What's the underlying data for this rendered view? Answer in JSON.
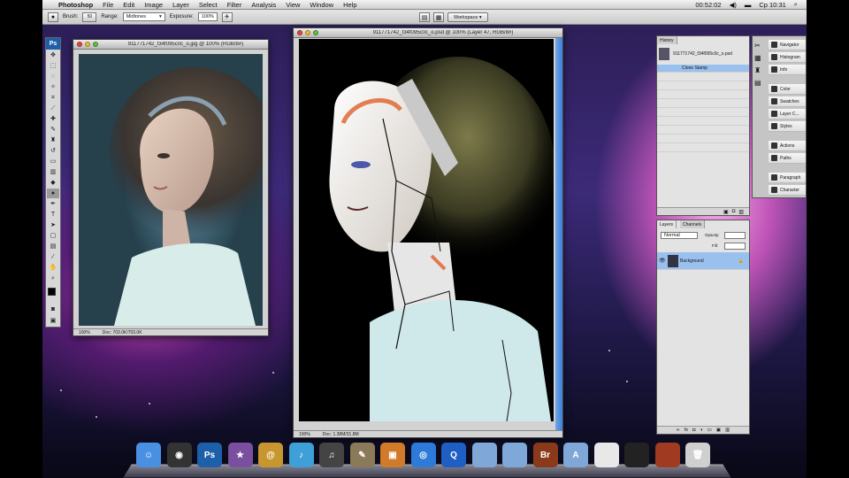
{
  "menubar": {
    "apple": "",
    "app_name": "Photoshop",
    "items": [
      "File",
      "Edit",
      "Image",
      "Layer",
      "Select",
      "Filter",
      "Analysis",
      "View",
      "Window",
      "Help"
    ],
    "clock_small": "00:52:02",
    "clock": "Cp 10:31"
  },
  "optionsbar": {
    "brush_label": "Brush:",
    "brush_size": "50",
    "range_label": "Range:",
    "range_value": "Midtones",
    "exposure_label": "Exposure:",
    "exposure_value": "100%",
    "workspace_label": "Workspace ▾"
  },
  "toolbox": {
    "logo": "Ps"
  },
  "doc_left": {
    "title": "911771742_f34f095c0c_o.jpg @ 100% (RGB/8#)",
    "zoom": "100%",
    "doc_size": "Doc: 703.0K/703.0K"
  },
  "doc_right": {
    "title": "911771742_f34f095c0c_o.psd @ 100% (Layer 47, RGB/8#)",
    "zoom": "100%",
    "doc_size": "Doc: 1.38M/31.8M"
  },
  "history_panel": {
    "tab": "History",
    "snapshot": "911771742_f34f095c0c_o.psd",
    "selected_item": "Clone Stamp"
  },
  "layers_panel": {
    "tab_layers": "Layers",
    "tab_channels": "Channels",
    "blend_mode": "Normal",
    "opacity_label": "Opacity:",
    "fill_label": "Fill:",
    "layer_name": "Background"
  },
  "dock_panels": [
    "Navigator",
    "Histogram",
    "Info",
    "Color",
    "Swatches",
    "Layer C...",
    "Styles",
    "Actions",
    "Paths",
    "Paragraph",
    "Character"
  ],
  "dock_apps": [
    {
      "name": "finder-icon",
      "glyph": "☺",
      "color": "#4a90e2"
    },
    {
      "name": "dashboard-icon",
      "glyph": "◉",
      "color": "#333333"
    },
    {
      "name": "photoshop-icon",
      "glyph": "Ps",
      "color": "#1d5fa8"
    },
    {
      "name": "imovie-icon",
      "glyph": "★",
      "color": "#7a4fa0"
    },
    {
      "name": "address-book-icon",
      "glyph": "@",
      "color": "#c8962f"
    },
    {
      "name": "itunes-icon",
      "glyph": "♪",
      "color": "#3fa0d8"
    },
    {
      "name": "garageband-icon",
      "glyph": "♫",
      "color": "#444444"
    },
    {
      "name": "preview-icon",
      "glyph": "✎",
      "color": "#8a7a5a"
    },
    {
      "name": "iphoto-icon",
      "glyph": "▣",
      "color": "#d07a2a"
    },
    {
      "name": "safari-icon",
      "glyph": "◎",
      "color": "#2e7ad8"
    },
    {
      "name": "quicktime-icon",
      "glyph": "Q",
      "color": "#1f5fc4"
    },
    {
      "name": "folder-icon",
      "glyph": "",
      "color": "#7fa8d8"
    },
    {
      "name": "folder-icon-2",
      "glyph": "",
      "color": "#7fa8d8"
    },
    {
      "name": "bridge-icon",
      "glyph": "Br",
      "color": "#8a3a1a"
    },
    {
      "name": "applications-folder-icon",
      "glyph": "A",
      "color": "#7fa8d8"
    },
    {
      "name": "document-icon",
      "glyph": "",
      "color": "#e8e8e8"
    },
    {
      "name": "psd-file-icon",
      "glyph": "",
      "color": "#222222"
    },
    {
      "name": "psd-file-icon-2",
      "glyph": "",
      "color": "#a03a20"
    },
    {
      "name": "trash-icon",
      "glyph": "🗑",
      "color": "#cfcfcf"
    }
  ]
}
